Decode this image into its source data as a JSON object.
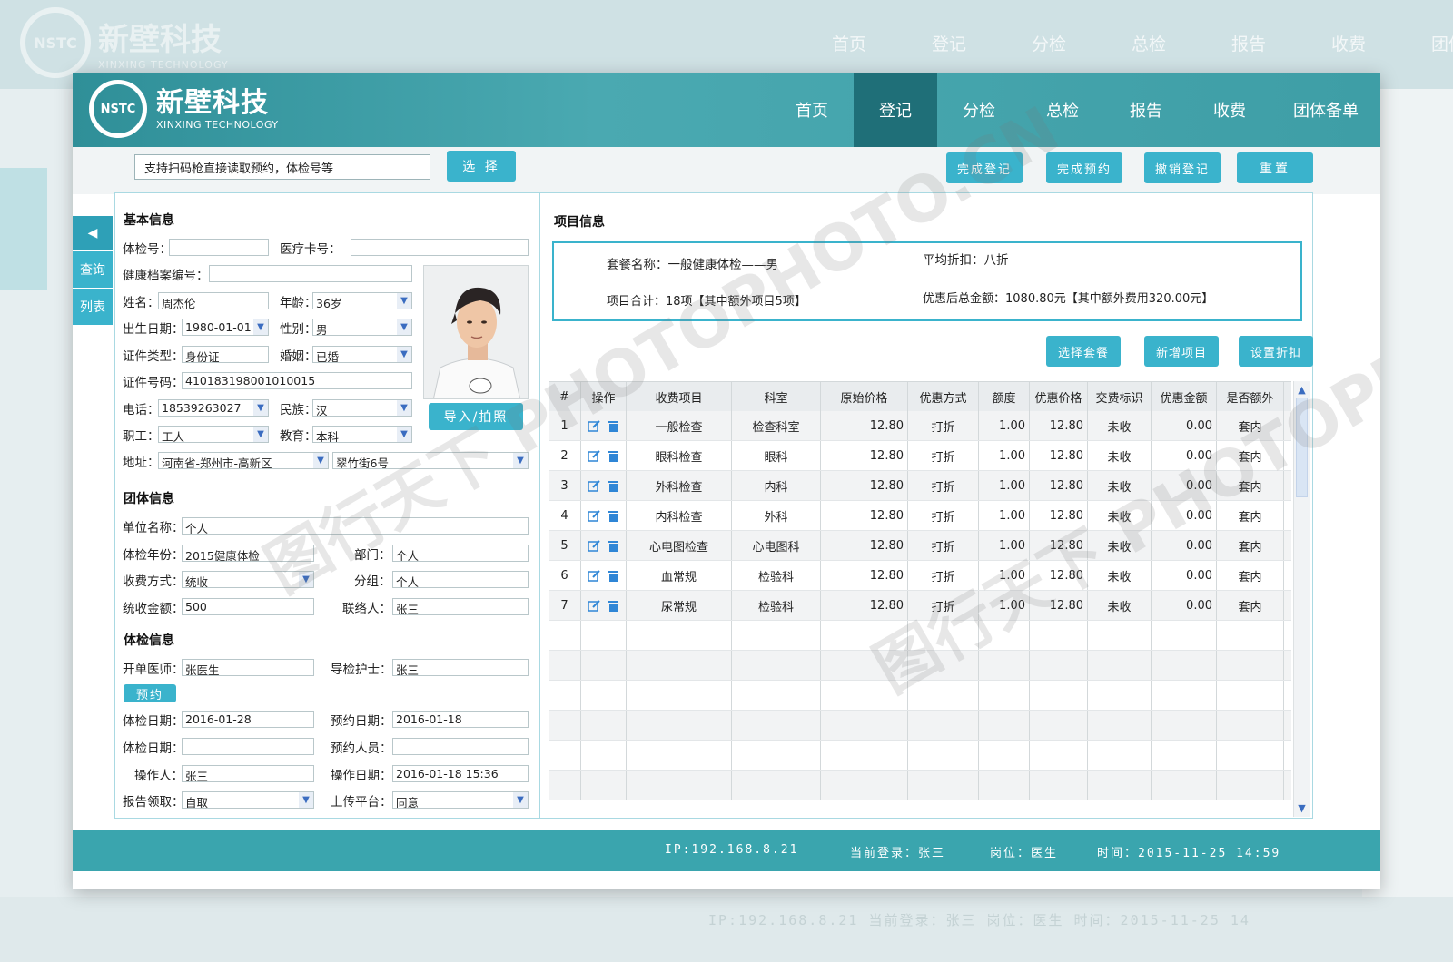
{
  "background": {
    "logo": {
      "badge": "NSTC",
      "cn": "新壁科技",
      "en": "XINXING TECHNOLOGY"
    },
    "nav": [
      "首页",
      "登记",
      "分检",
      "总检",
      "报告",
      "收费",
      "团体"
    ],
    "status": "IP:192.168.8.21    当前登录：张三    岗位：医生    时间：2015-11-25  14"
  },
  "header": {
    "logo_badge": "NSTC",
    "logo_cn": "新壁科技",
    "logo_en": "XINXING TECHNOLOGY",
    "nav": [
      {
        "label": "首页"
      },
      {
        "label": "登记"
      },
      {
        "label": "分检"
      },
      {
        "label": "总检"
      },
      {
        "label": "报告"
      },
      {
        "label": "收费"
      },
      {
        "label": "团体备单"
      }
    ],
    "active": "登记"
  },
  "toolbar": {
    "scan_value": "支持扫码枪直接读取预约，体检号等",
    "select_button": "选 择",
    "complete_register": "完成登记",
    "complete_reserve": "完成预约",
    "cancel_register": "撤销登记",
    "reset": "重置"
  },
  "sidetabs": {
    "query": "查询",
    "list": "列表"
  },
  "basic": {
    "title": "基本信息",
    "exam_no_label": "体检号：",
    "exam_no": "",
    "medical_card_label": "医疗卡号：",
    "medical_card": "",
    "health_record_label": "健康档案编号：",
    "health_record": "",
    "name_label": "姓名：",
    "name": "周杰伦",
    "age_label": "年龄：",
    "age": "36岁",
    "birth_label": "出生日期：",
    "birth": "1980-01-01",
    "gender_label": "性别：",
    "gender": "男",
    "id_type_label": "证件类型：",
    "id_type": "身份证",
    "marriage_label": "婚姻：",
    "marriage": "已婚",
    "id_no_label": "证件号码：",
    "id_no": "410183198001010015",
    "phone_label": "电话：",
    "phone": "18539263027",
    "ethnic_label": "民族：",
    "ethnic": "汉",
    "job_label": "职工：",
    "job": "工人",
    "edu_label": "教育：",
    "edu": "本科",
    "addr_label": "地址：",
    "addr1": "河南省-郑州市-高新区",
    "addr2": "翠竹街6号",
    "photo_button": "导入/拍照"
  },
  "group": {
    "title": "团体信息",
    "unit_label": "单位名称：",
    "unit": "个人",
    "year_label": "体检年份：",
    "year": "2015健康体检",
    "dept_label": "部门：",
    "dept": "个人",
    "pay_label": "收费方式：",
    "pay": "统收",
    "sub_label": "分组：",
    "sub": "个人",
    "amount_label": "统收金额：",
    "amount": "500",
    "contact_label": "联络人：",
    "contact": "张三"
  },
  "exam": {
    "title": "体检信息",
    "doctor_label": "开单医师：",
    "doctor": "张医生",
    "nurse_label": "导检护士：",
    "nurse": "张三",
    "reserve_button": "预约",
    "date_label": "体检日期：",
    "date": "2016-01-28",
    "reserve_date_label": "预约日期：",
    "reserve_date": "2016-01-18",
    "date2_label": "体检日期：",
    "date2": "",
    "reserve_person_label": "预约人员：",
    "reserve_person": "",
    "operator_label": "操作人：",
    "operator": "张三",
    "op_date_label": "操作日期：",
    "op_date": "2016-01-18 15:36",
    "report_label": "报告领取：",
    "report": "自取",
    "upload_label": "上传平台：",
    "upload": "同意"
  },
  "project": {
    "title": "项目信息",
    "package_label": "套餐名称：",
    "package": "一般健康体检——男",
    "discount_label": "平均折扣：",
    "discount": "八折",
    "total_label": "项目合计：",
    "total": "18项【其中额外项目5项】",
    "amount_label": "优惠后总金额：",
    "amount": "1080.80元【其中额外费用320.00元】",
    "btn_select": "选择套餐",
    "btn_add": "新增项目",
    "btn_discount": "设置折扣"
  },
  "table": {
    "headers": [
      "#",
      "操作",
      "收费项目",
      "科室",
      "原始价格",
      "优惠方式",
      "额度",
      "优惠价格",
      "交费标识",
      "优惠金额",
      "是否额外"
    ],
    "rows": [
      [
        "1",
        "一般检查",
        "检查科室",
        "12.80",
        "打折",
        "1.00",
        "12.80",
        "未收",
        "0.00",
        "套内"
      ],
      [
        "2",
        "眼科检查",
        "眼科",
        "12.80",
        "打折",
        "1.00",
        "12.80",
        "未收",
        "0.00",
        "套内"
      ],
      [
        "3",
        "外科检查",
        "内科",
        "12.80",
        "打折",
        "1.00",
        "12.80",
        "未收",
        "0.00",
        "套内"
      ],
      [
        "4",
        "内科检查",
        "外科",
        "12.80",
        "打折",
        "1.00",
        "12.80",
        "未收",
        "0.00",
        "套内"
      ],
      [
        "5",
        "心电图检查",
        "心电图科",
        "12.80",
        "打折",
        "1.00",
        "12.80",
        "未收",
        "0.00",
        "套内"
      ],
      [
        "6",
        "血常规",
        "检验科",
        "12.80",
        "打折",
        "1.00",
        "12.80",
        "未收",
        "0.00",
        "套内"
      ],
      [
        "7",
        "尿常规",
        "检验科",
        "12.80",
        "打折",
        "1.00",
        "12.80",
        "未收",
        "0.00",
        "套内"
      ]
    ]
  },
  "footer": {
    "ip": "IP:192.168.8.21",
    "login": "当前登录：张三",
    "post": "岗位：医生",
    "time": "时间：2015-11-25   14:59"
  },
  "watermark": "图行天下 PHOTOPHOTO.CN",
  "colors": {
    "header": "#3a9ea6",
    "active_nav": "#1f6f78",
    "button": "#3ab3cc",
    "footer": "#3aa5ae"
  }
}
